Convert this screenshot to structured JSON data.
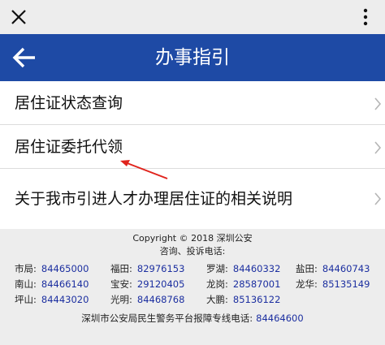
{
  "header": {
    "title": "办事指引"
  },
  "menu": {
    "items": [
      {
        "label": "居住证状态查询"
      },
      {
        "label": "居住证委托代领"
      },
      {
        "label": "关于我市引进人才办理居住证的相关说明"
      }
    ]
  },
  "footer": {
    "copyright": "Copyright © 2018 深圳公安",
    "consult_label": "咨询、投诉电话:",
    "contacts": [
      [
        {
          "name": "市局:",
          "phone": "84465000"
        },
        {
          "name": "福田:",
          "phone": "82976153"
        },
        {
          "name": "罗湖:",
          "phone": "84460332"
        },
        {
          "name": "盐田:",
          "phone": "84460743"
        }
      ],
      [
        {
          "name": "南山:",
          "phone": "84466140"
        },
        {
          "name": "宝安:",
          "phone": "29120405"
        },
        {
          "name": "龙岗:",
          "phone": "28587001"
        },
        {
          "name": "龙华:",
          "phone": "85135149"
        }
      ],
      [
        {
          "name": "坪山:",
          "phone": "84443020"
        },
        {
          "name": "光明:",
          "phone": "84468768"
        },
        {
          "name": "大鹏:",
          "phone": "85136122"
        }
      ]
    ],
    "hotline_label": "深圳市公安局民生警务平台报障专线电话:",
    "hotline_phone": "84464600"
  },
  "colors": {
    "header_bg": "#1e4aa5",
    "link": "#1c2fa0",
    "annotation": "#e0231c"
  },
  "icons": {
    "close": "close-icon",
    "more": "more-vertical-icon",
    "back": "arrow-left-icon",
    "chevron": "chevron-right-icon"
  }
}
